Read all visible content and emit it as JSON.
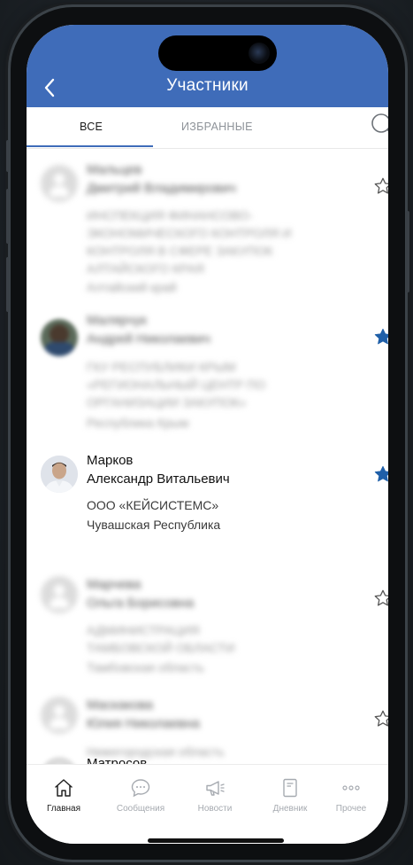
{
  "header": {
    "title": "Участники",
    "back_icon": "chevron-left-icon"
  },
  "tabs": [
    {
      "label": "ВСЕ",
      "active": true
    },
    {
      "label": "ИЗБРАННЫЕ",
      "active": false
    }
  ],
  "colors": {
    "brand": "#3f6cb9",
    "star_active": "#1f5fa8",
    "inactive": "#a6aab0"
  },
  "participants": [
    {
      "last_name": "Мальцев",
      "full_first": "Дмитрий Владимирович",
      "org": [
        "ИНСПЕКЦИЯ ФИНАНСОВО-",
        "ЭКОНОМИЧЕСКОГО КОНТРОЛЯ И",
        "КОНТРОЛЯ В СФЕРЕ ЗАКУПОК",
        "АЛТАЙСКОГО КРАЯ"
      ],
      "region": "Алтайский край",
      "favorite": false,
      "blurred": true
    },
    {
      "last_name": "Малярчук",
      "full_first": "Андрей Николаевич",
      "org": [
        "ГКУ РЕСПУБЛИКИ КРЫМ",
        "«РЕГИОНАЛЬНЫЙ ЦЕНТР ПО",
        "ОРГАНИЗАЦИИ ЗАКУПОК»"
      ],
      "region": "Республика Крым",
      "favorite": true,
      "blurred": true
    },
    {
      "last_name": "Марков",
      "full_first": "Александр Витальевич",
      "org": [
        "ООО «КЕЙСИСТЕМС»"
      ],
      "region": "Чувашская Республика",
      "favorite": true,
      "blurred": false
    },
    {
      "last_name": "Марчева",
      "full_first": "Ольга Борисовна",
      "org": [
        "АДМИНИСТРАЦИЯ",
        "ТАМБОВСКОЙ ОБЛАСТИ"
      ],
      "region": "Тамбовская область",
      "favorite": false,
      "blurred": true
    },
    {
      "last_name": "Маскакова",
      "full_first": "Юлия Николаевна",
      "org": [],
      "region": "Нижегородская область",
      "favorite": false,
      "blurred": true
    },
    {
      "last_name": "Матросов",
      "full_first": "",
      "org": [],
      "region": "",
      "favorite": false,
      "blurred": false
    }
  ],
  "tabbar": [
    {
      "label": "Главная",
      "icon": "home-icon",
      "active": true
    },
    {
      "label": "Сообщения",
      "icon": "chat-icon",
      "active": false
    },
    {
      "label": "Новости",
      "icon": "megaphone-icon",
      "active": false
    },
    {
      "label": "Дневник",
      "icon": "notebook-icon",
      "active": false
    },
    {
      "label": "Прочее",
      "icon": "more-icon",
      "active": false
    }
  ]
}
